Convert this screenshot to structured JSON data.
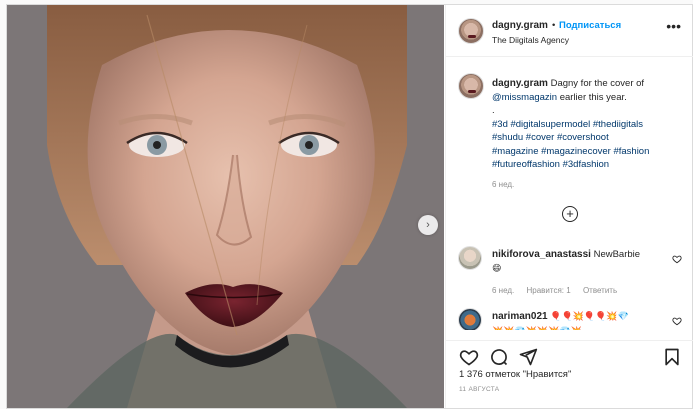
{
  "post": {
    "author": {
      "username": "dagny.gram",
      "follow_label": "Подписаться",
      "subtitle": "The Diigitals Agency",
      "separator": "•"
    },
    "more_icon": "more-horizontal-icon",
    "caption": {
      "username": "dagny.gram",
      "text": "Dagny for the cover of",
      "mention": "@missmagazin",
      "text_after": "earlier this year.",
      "dot_line": ".",
      "hashtags_line1": "#3d #digitalsupermodel #thediigitals",
      "hashtags_line2": "#shudu #cover #covershoot",
      "hashtags_line3": "#magazine #magazinecover #fashion",
      "hashtags_line4": "#futureoffashion #3dfashion",
      "time": "6 нед."
    },
    "load_more_icon": "plus-circle-icon",
    "comments": [
      {
        "username": "nikiforova_anastassi",
        "text": "NewBarbie",
        "emoji": "😄",
        "time": "6 нед.",
        "likes_label": "Нравится: 1",
        "reply_label": "Ответить"
      },
      {
        "username": "nariman021",
        "emoji_line1": "🎈🎈💥🎈🎈💥💎",
        "emoji_line2": "💥💥💎💥💥💥💎💥"
      }
    ],
    "actions": {
      "like_icon": "heart-icon",
      "comment_icon": "comment-icon",
      "share_icon": "share-icon",
      "save_icon": "bookmark-icon"
    },
    "likes_text": "1 376 отметок \"Нравится\"",
    "date": "11 АВГУСТА"
  },
  "carousel": {
    "next_icon": "chevron-right-icon"
  },
  "colors": {
    "link": "#00376b",
    "follow": "#0095f6",
    "muted": "#8e8e8e",
    "lips": "#5a1a20"
  }
}
